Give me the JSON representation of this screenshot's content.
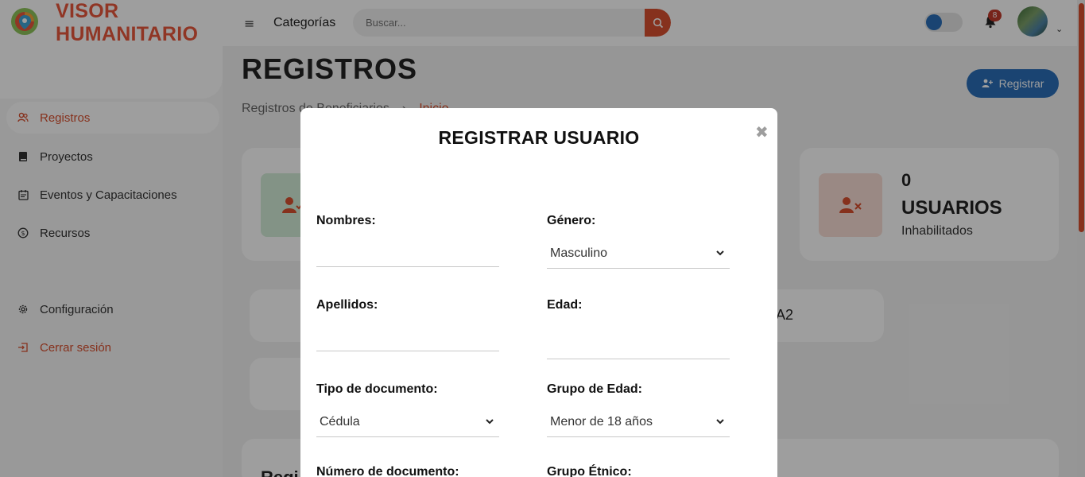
{
  "brand": {
    "line1": "VISOR",
    "line2": "HUMANITARIO",
    "accent": "#e8573c"
  },
  "sidebar": {
    "items": [
      {
        "label": "Registros",
        "icon": "users-icon",
        "active": true
      },
      {
        "label": "Proyectos",
        "icon": "book-icon"
      },
      {
        "label": "Eventos y Capacitaciones",
        "icon": "calendar-icon"
      },
      {
        "label": "Recursos",
        "icon": "dollar-circle-icon"
      },
      {
        "label": "Configuración",
        "icon": "gear-icon"
      },
      {
        "label": "Cerrar sesión",
        "icon": "logout-icon"
      }
    ]
  },
  "topbar": {
    "categories_label": "Categorías",
    "search_placeholder": "Buscar...",
    "notifications_count": "8"
  },
  "page": {
    "title": "REGISTROS",
    "breadcrumb": [
      "Registros de Beneficiarios",
      "Inicio"
    ],
    "register_button": "Registrar"
  },
  "cards": {
    "disabled_count": "0",
    "disabled_label": "USUARIOS",
    "disabled_sub": "Inhabilitados",
    "partial_text": "A2",
    "section_partial": "Regi"
  },
  "modal": {
    "title": "REGISTRAR USUARIO",
    "fields": {
      "nombres_label": "Nombres:",
      "apellidos_label": "Apellidos:",
      "tipo_doc_label": "Tipo de documento:",
      "tipo_doc_value": "Cédula",
      "num_doc_label": "Número de documento:",
      "genero_label": "Género:",
      "genero_value": "Masculino",
      "edad_label": "Edad:",
      "grupo_edad_label": "Grupo de Edad:",
      "grupo_edad_value": "Menor de 18 años",
      "grupo_etnico_label": "Grupo Étnico:"
    }
  },
  "colors": {
    "primary": "#2a6fb8",
    "accent": "#d9502f",
    "success_bg": "#d4edd8",
    "danger_bg": "#f8ddd5"
  }
}
